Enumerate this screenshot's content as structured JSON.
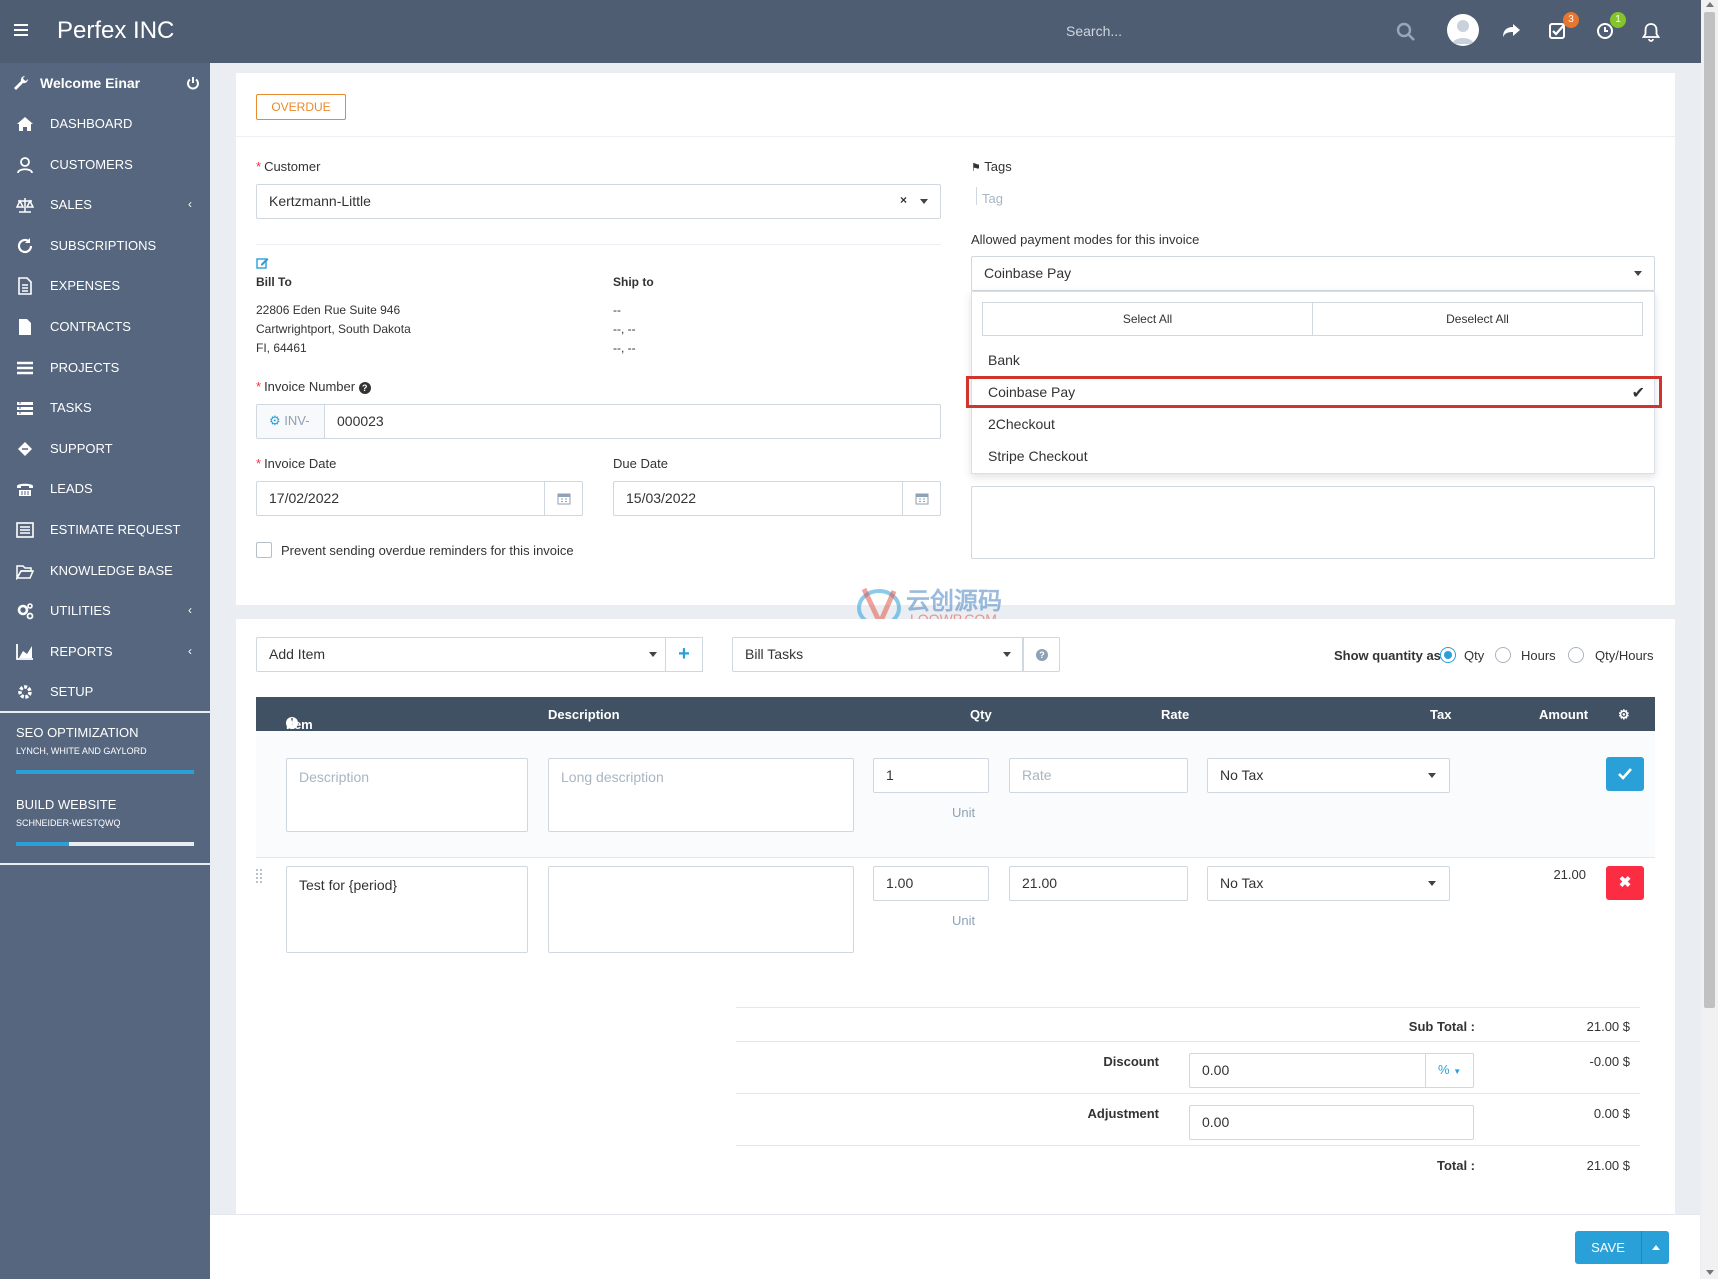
{
  "header": {
    "brand": "Perfex INC",
    "search_placeholder": "Search...",
    "badge_todos": "3",
    "badge_timers": "1"
  },
  "sidebar": {
    "welcome": "Welcome Einar",
    "items": [
      {
        "label": "DASHBOARD",
        "icon": "home-icon"
      },
      {
        "label": "CUSTOMERS",
        "icon": "user-icon"
      },
      {
        "label": "SALES",
        "icon": "balance-scale-icon",
        "chevron": "‹"
      },
      {
        "label": "SUBSCRIPTIONS",
        "icon": "refresh-icon"
      },
      {
        "label": "EXPENSES",
        "icon": "file-text-icon"
      },
      {
        "label": "CONTRACTS",
        "icon": "file-icon"
      },
      {
        "label": "PROJECTS",
        "icon": "bars-icon"
      },
      {
        "label": "TASKS",
        "icon": "tasks-icon"
      },
      {
        "label": "SUPPORT",
        "icon": "ticket-icon"
      },
      {
        "label": "LEADS",
        "icon": "tty-icon"
      },
      {
        "label": "ESTIMATE REQUEST",
        "icon": "list-alt-icon"
      },
      {
        "label": "KNOWLEDGE BASE",
        "icon": "folder-open-icon"
      },
      {
        "label": "UTILITIES",
        "icon": "cogs-icon",
        "chevron": "‹"
      },
      {
        "label": "REPORTS",
        "icon": "area-chart-icon",
        "chevron": "‹"
      },
      {
        "label": "SETUP",
        "icon": "cog-icon"
      }
    ],
    "projects": [
      {
        "title": "SEO OPTIMIZATION",
        "sub": "LYNCH, WHITE AND GAYLORD",
        "progress": 1.0
      },
      {
        "title": "BUILD WEBSITE",
        "sub": "SCHNEIDER-WESTQWQ",
        "progress": 0.3
      }
    ]
  },
  "invoice": {
    "status": "OVERDUE",
    "customer_label": "Customer",
    "customer_value": "Kertzmann-Little",
    "bill_to_label": "Bill To",
    "bill_to": [
      "22806 Eden Rue Suite 946",
      "Cartwrightport, South Dakota",
      "FI, 64461"
    ],
    "ship_to_label": "Ship to",
    "ship_to": [
      "--",
      "--, --",
      "--, --"
    ],
    "invoice_number_label": "Invoice Number",
    "invoice_prefix": "INV-",
    "invoice_number": "000023",
    "invoice_date_label": "Invoice Date",
    "invoice_date": "17/02/2022",
    "due_date_label": "Due Date",
    "due_date": "15/03/2022",
    "prevent_reminders_label": "Prevent sending overdue reminders for this invoice",
    "tags_label": "Tags",
    "tag_placeholder": "Tag",
    "payment_modes_label": "Allowed payment modes for this invoice",
    "payment_modes_selected": "Coinbase Pay",
    "select_all": "Select All",
    "deselect_all": "Deselect All",
    "payment_options": [
      {
        "label": "Bank",
        "selected": false
      },
      {
        "label": "Coinbase Pay",
        "selected": true
      },
      {
        "label": "2Checkout",
        "selected": false
      },
      {
        "label": "Stripe Checkout",
        "selected": false
      }
    ]
  },
  "watermark": {
    "cn": "云创源码",
    "en": "LOOWP.COM"
  },
  "items": {
    "add_item": "Add Item",
    "bill_tasks": "Bill Tasks",
    "show_qty_label": "Show quantity as:",
    "qty_options": [
      "Qty",
      "Hours",
      "Qty/Hours"
    ],
    "headers": {
      "item": "Item",
      "description": "Description",
      "qty": "Qty",
      "rate": "Rate",
      "tax": "Tax",
      "amount": "Amount"
    },
    "new_row": {
      "desc_ph": "Description",
      "long_ph": "Long description",
      "qty": "1",
      "rate_ph": "Rate",
      "tax": "No Tax",
      "unit": "Unit"
    },
    "rows": [
      {
        "description": "Test for {period}",
        "long_description": "",
        "qty": "1.00",
        "rate": "21.00",
        "tax": "No Tax",
        "unit": "Unit",
        "amount": "21.00"
      }
    ]
  },
  "totals": {
    "sub_total_label": "Sub Total :",
    "sub_total": "21.00 $",
    "discount_label": "Discount",
    "discount_value": "0.00",
    "discount_type": "%",
    "discount_amount": "-0.00 $",
    "adjustment_label": "Adjustment",
    "adjustment_value": "0.00",
    "adjustment_amount": "0.00 $",
    "total_label": "Total :",
    "total": "21.00 $"
  },
  "footer": {
    "save_label": "SAVE"
  },
  "colors": {
    "topbar": "#4f5d73",
    "sidebar": "#56667e",
    "accent": "#2aa0d9",
    "danger": "#fc2d42",
    "overdue": "#e88a2e",
    "table_header": "#415164"
  }
}
